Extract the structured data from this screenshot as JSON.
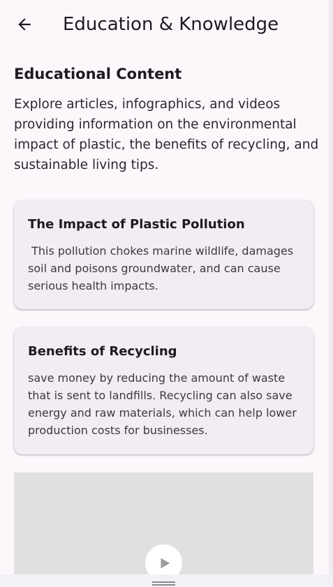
{
  "appbar": {
    "title": "Education & Knowledge",
    "back_icon": "arrow-left-icon"
  },
  "content": {
    "heading": "Educational Content",
    "intro": "Explore articles, infographics, and videos providing information on the environmental impact of plastic, the benefits of recycling, and sustainable living tips."
  },
  "cards": [
    {
      "title": "The Impact of Plastic Pollution",
      "body": " This pollution chokes marine wildlife, damages soil and poisons groundwater, and can cause serious health impacts."
    },
    {
      "title": "Benefits of Recycling",
      "body": "save money by reducing the amount of waste that is sent to landfills. Recycling can also save energy and raw materials, which can help lower production costs for businesses."
    }
  ],
  "video": {
    "play_icon": "play-icon"
  },
  "colors": {
    "background": "#fdf7fc",
    "card": "#f2edf3",
    "video_placeholder": "#e0e0e0"
  }
}
